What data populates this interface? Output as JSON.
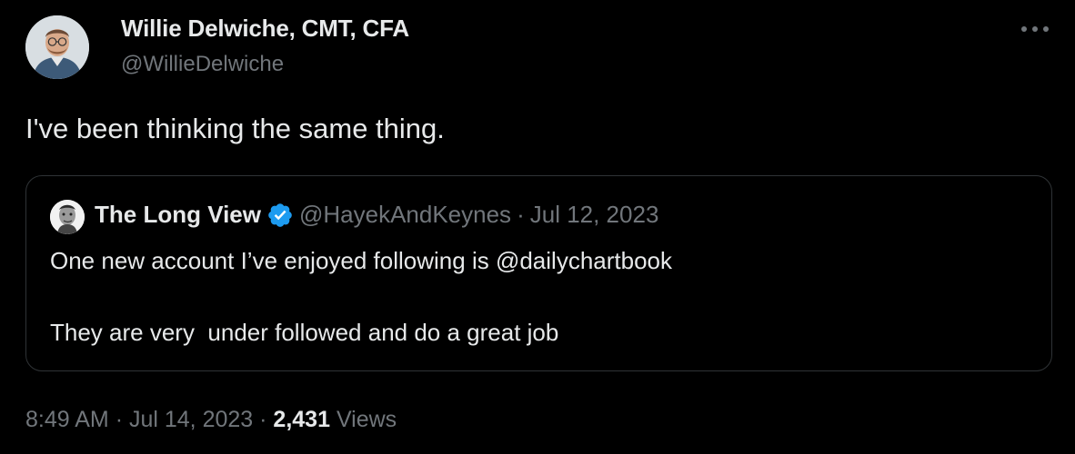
{
  "author": {
    "name": "Willie Delwiche, CMT, CFA",
    "handle": "@WillieDelwiche"
  },
  "more_icon": "more-horizontal-icon",
  "tweet": {
    "text": "I've been thinking the same thing."
  },
  "quoted": {
    "name": "The Long View",
    "verified_icon": "verified-badge-icon",
    "verified_color": "#1d9bf0",
    "handle": "@HayekAndKeynes",
    "separator": "·",
    "date": "Jul 12, 2023",
    "line1": "One new account I’ve enjoyed following is @dailychartbook",
    "line2": "They are very  under followed and do a great job"
  },
  "meta": {
    "time": "8:49 AM",
    "separator1": "·",
    "date": "Jul 14, 2023",
    "separator2": "·",
    "views_count": "2,431",
    "views_label": "Views"
  },
  "colors": {
    "background": "#000000",
    "text_primary": "#e7e9ea",
    "text_secondary": "#71767b",
    "border": "#2f3336"
  }
}
